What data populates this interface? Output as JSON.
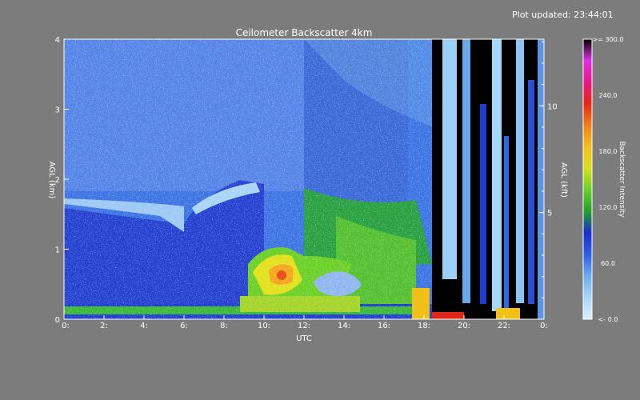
{
  "header": {
    "updated": "Plot updated: 23:44:01"
  },
  "chart_data": {
    "type": "heatmap",
    "title": "Ceilometer Backscatter 4km",
    "xlabel": "UTC",
    "ylabel_left": "AGL (km)",
    "ylabel_right": "AGL (kft)",
    "colorbar_label": "Backscatter Intensity",
    "x_ticks": [
      "0:",
      "2:",
      "4:",
      "6:",
      "8:",
      "10:",
      "12:",
      "14:",
      "16:",
      "18:",
      "20:",
      "22:",
      "0:"
    ],
    "x_range_hours": [
      0,
      24
    ],
    "y_ticks_km": [
      "0",
      "1",
      "2",
      "3",
      "4"
    ],
    "y_range_km": [
      0,
      4
    ],
    "y_ticks_kft": [
      "5",
      "10"
    ],
    "y_kft_values": [
      5,
      10
    ],
    "colorbar_ticks": [
      "<-   0.0",
      "60.0",
      "120.0",
      "180.0",
      "240.0",
      ">= 300.0"
    ],
    "colorbar_range": [
      0,
      300
    ],
    "colorscale": [
      "#d8f0ff",
      "#a8d8f8",
      "#6aaef0",
      "#2c60e6",
      "#1a2ed2",
      "#22a028",
      "#6ad026",
      "#d8e018",
      "#f6c018",
      "#f28018",
      "#e82810",
      "#e81888",
      "#e030e6",
      "#000000"
    ],
    "colors": {
      "background": "#7c7c7c",
      "text": "#ffffff"
    }
  }
}
